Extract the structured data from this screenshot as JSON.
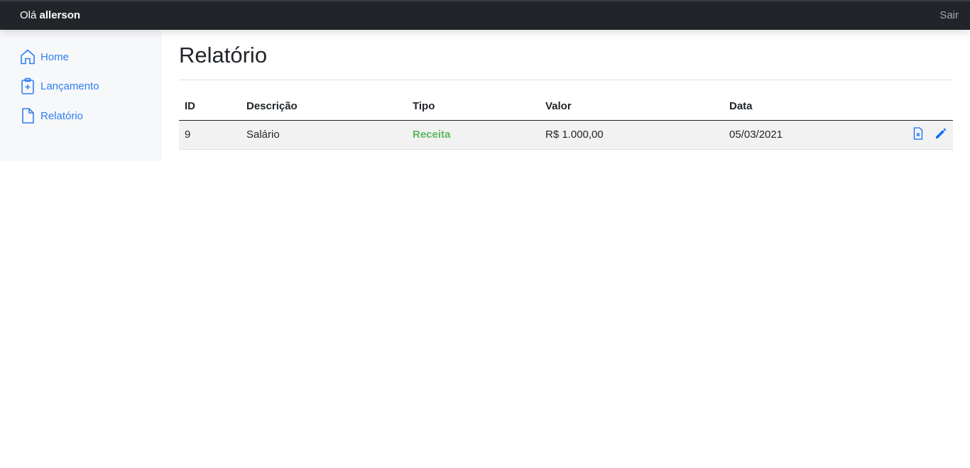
{
  "header": {
    "greeting_prefix": "Olá",
    "username": "allerson",
    "logout_label": "Sair"
  },
  "sidebar": {
    "items": [
      {
        "label": "Home",
        "icon": "home-icon"
      },
      {
        "label": "Lançamento",
        "icon": "clipboard-plus-icon"
      },
      {
        "label": "Relatório",
        "icon": "file-icon"
      }
    ]
  },
  "page": {
    "title": "Relatório"
  },
  "table": {
    "columns": [
      "ID",
      "Descrição",
      "Tipo",
      "Valor",
      "Data"
    ],
    "rows": [
      {
        "id": "9",
        "descricao": "Salário",
        "tipo": "Receita",
        "valor": "R$ 1.000,00",
        "data": "05/03/2021",
        "actions": [
          "file-delete-icon",
          "pencil-edit-icon"
        ]
      }
    ]
  },
  "colors": {
    "navbar_bg": "#212529",
    "link": "#2f7ef0",
    "receita": "#5cb85c",
    "action_icon": "#0d6efd"
  }
}
